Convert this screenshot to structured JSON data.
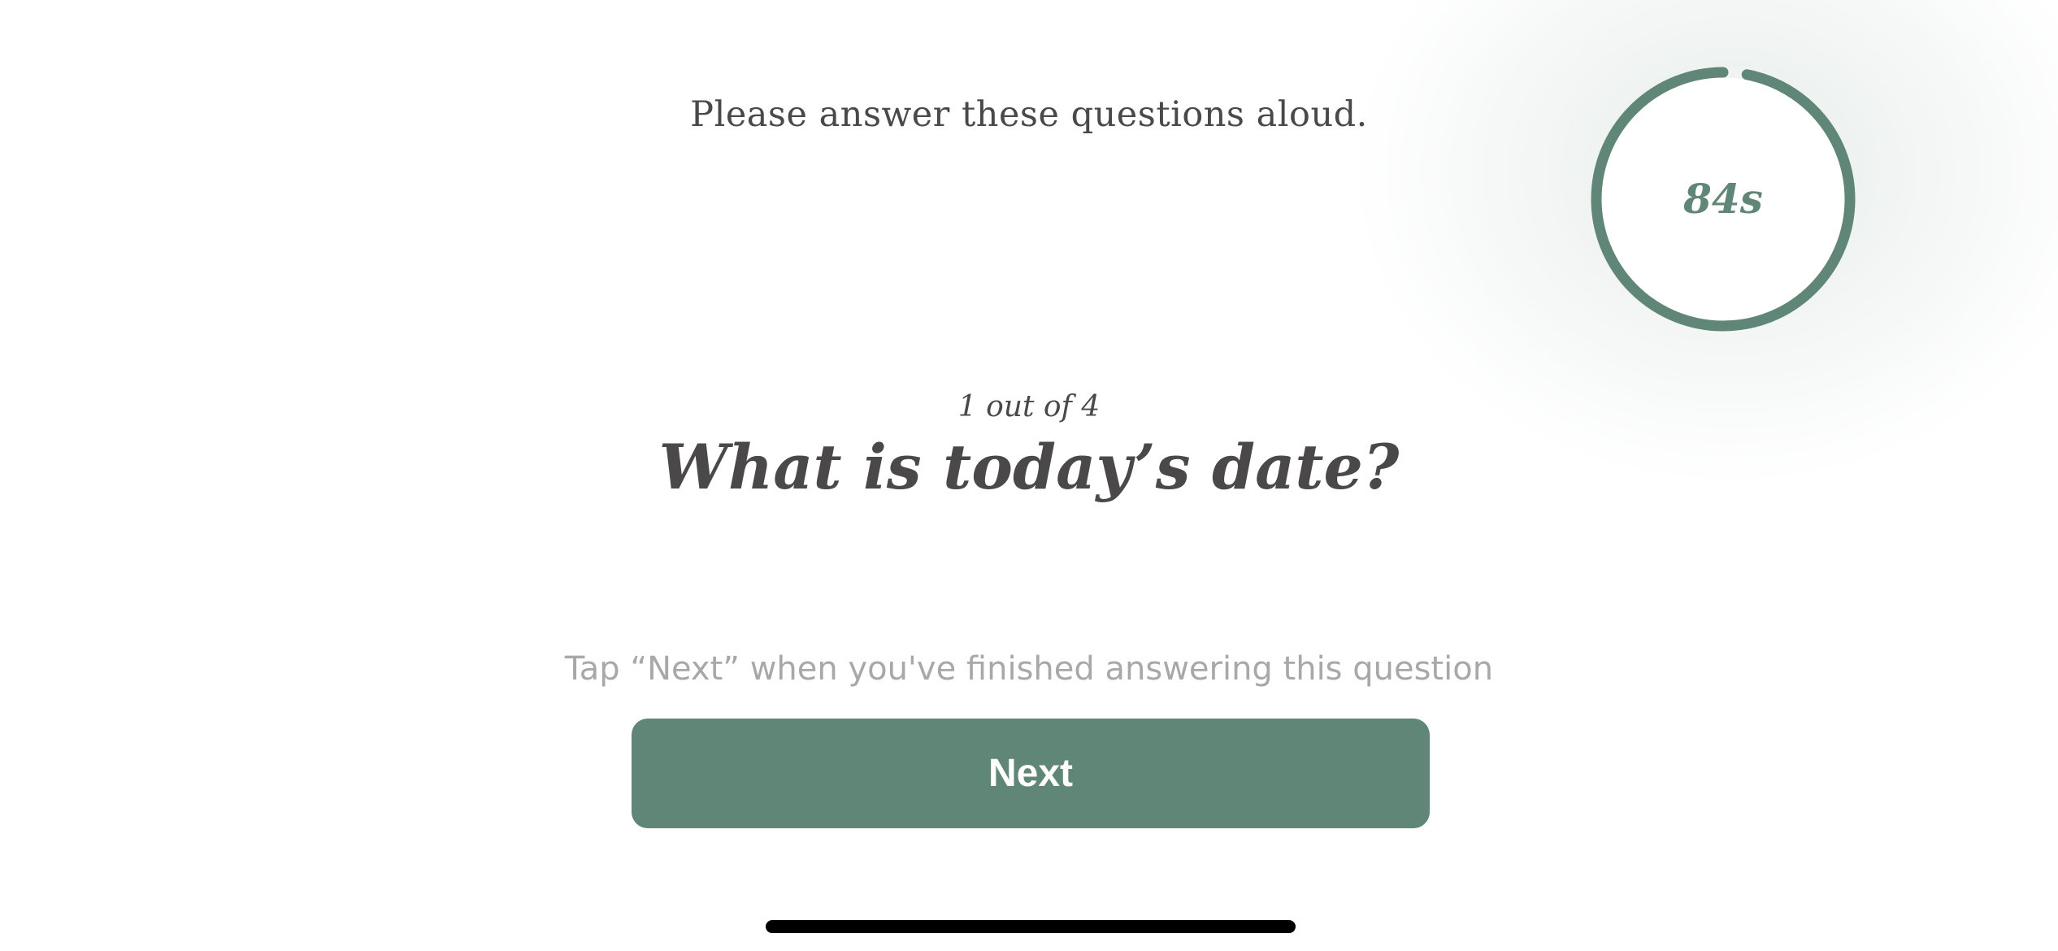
{
  "screen": {
    "instruction": "Please answer these questions aloud.",
    "timer": {
      "label": "84s",
      "remaining_fraction": 0.97,
      "ring_color": "#5f8676",
      "track_color": "#f1f3f2"
    },
    "question": {
      "counter": "1 out of 4",
      "text": "What is today’s date?"
    },
    "hint": "Tap “Next” when you've finished answering this question",
    "next_button": {
      "label": "Next",
      "color": "#5f8676"
    }
  }
}
